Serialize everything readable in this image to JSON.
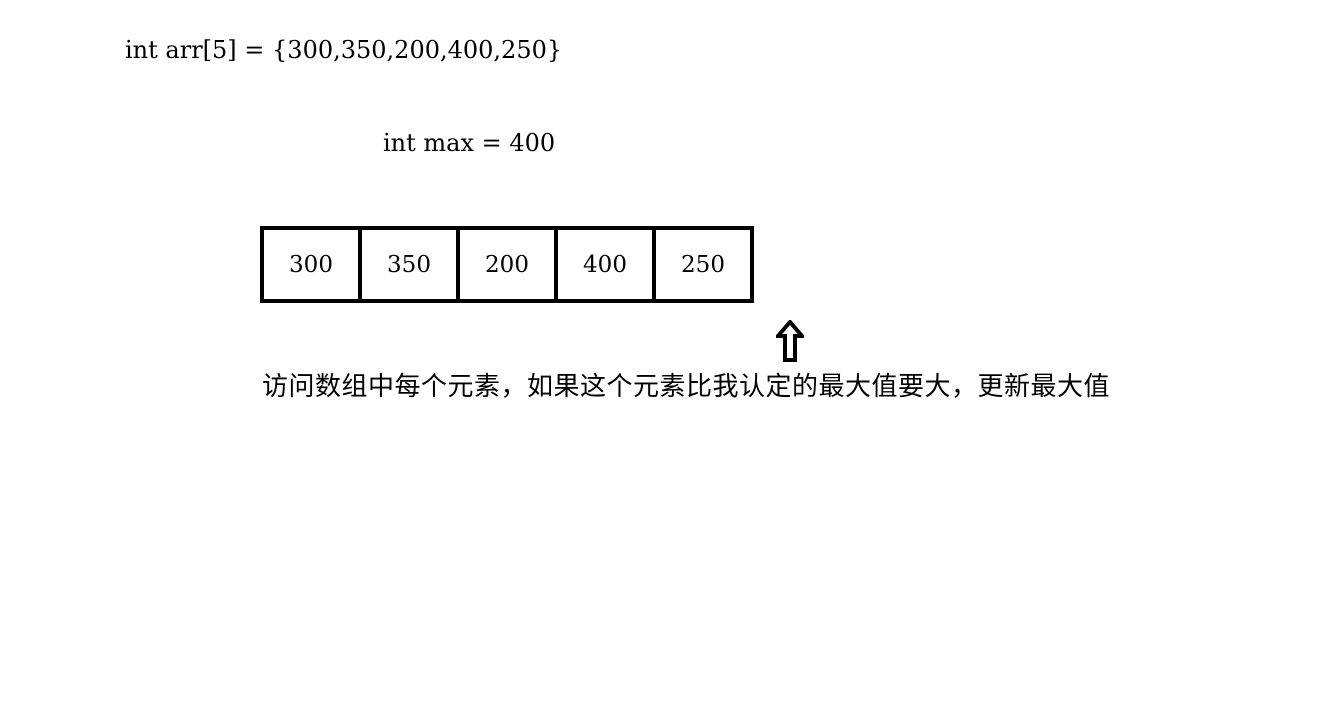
{
  "code": {
    "declaration": "int arr[5] = {300,350,200,400,250}",
    "max_assignment": "int max = 400"
  },
  "array": {
    "cells": [
      "300",
      "350",
      "200",
      "400",
      "250"
    ]
  },
  "arrow": {
    "icon": "up-arrow-icon"
  },
  "caption": "访问数组中每个元素，如果这个元素比我认定的最大值要大，更新最大值"
}
